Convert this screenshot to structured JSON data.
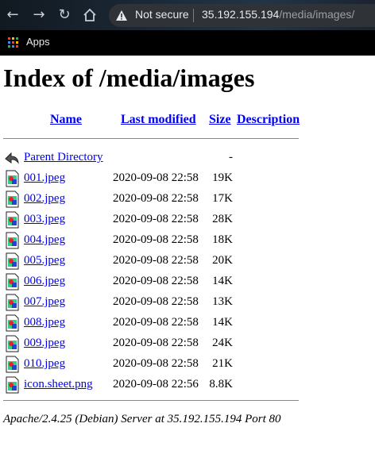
{
  "browser": {
    "security_label": "Not secure",
    "url_host": "35.192.155.194",
    "url_path": "/media/images/",
    "bookmarks": {
      "apps_label": "Apps"
    }
  },
  "page": {
    "title": "Index of /media/images",
    "columns": {
      "name": "Name",
      "last_modified": "Last modified",
      "size": "Size",
      "description": "Description"
    },
    "parent": {
      "name": "Parent Directory",
      "size": "-"
    },
    "files": [
      {
        "name": "001.jpeg",
        "modified": "2020-09-08 22:58",
        "size": "19K"
      },
      {
        "name": "002.jpeg",
        "modified": "2020-09-08 22:58",
        "size": "17K"
      },
      {
        "name": "003.jpeg",
        "modified": "2020-09-08 22:58",
        "size": "28K"
      },
      {
        "name": "004.jpeg",
        "modified": "2020-09-08 22:58",
        "size": "18K"
      },
      {
        "name": "005.jpeg",
        "modified": "2020-09-08 22:58",
        "size": "20K"
      },
      {
        "name": "006.jpeg",
        "modified": "2020-09-08 22:58",
        "size": "14K"
      },
      {
        "name": "007.jpeg",
        "modified": "2020-09-08 22:58",
        "size": "13K"
      },
      {
        "name": "008.jpeg",
        "modified": "2020-09-08 22:58",
        "size": "14K"
      },
      {
        "name": "009.jpeg",
        "modified": "2020-09-08 22:58",
        "size": "24K"
      },
      {
        "name": "010.jpeg",
        "modified": "2020-09-08 22:58",
        "size": "21K"
      },
      {
        "name": "icon.sheet.png",
        "modified": "2020-09-08 22:56",
        "size": "8.8K"
      }
    ],
    "server_signature": "Apache/2.4.25 (Debian) Server at 35.192.155.194 Port 80"
  }
}
